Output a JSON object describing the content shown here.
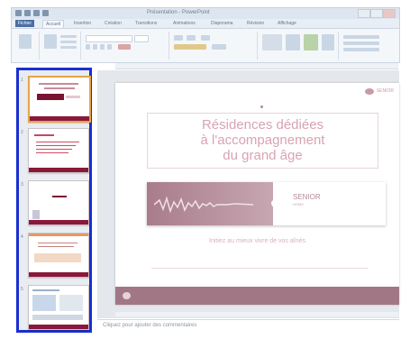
{
  "window": {
    "title": "Présentation - PowerPoint"
  },
  "ribbon": {
    "tabs": [
      "Fichier",
      "Accueil",
      "Insertion",
      "Création",
      "Transitions",
      "Animations",
      "Diaporama",
      "Révision",
      "Affichage"
    ],
    "active_tab": "Accueil"
  },
  "slides_panel": {
    "slides": [
      {
        "number": "1",
        "selected": true
      },
      {
        "number": "2",
        "selected": false
      },
      {
        "number": "3",
        "selected": false
      },
      {
        "number": "4",
        "selected": false
      },
      {
        "number": "5",
        "selected": false
      }
    ]
  },
  "slide": {
    "logo_text": "SENIOR",
    "title_lines": [
      "Résidences dédiées",
      "à l'accompagnement",
      "du grand âge"
    ],
    "band_brand": "SENIOR",
    "band_sub": "HOME",
    "band_sub2": "",
    "subtitle": "Initiez au mieux vivre de vos aînés",
    "footnote": "",
    "footer_text": ""
  },
  "notes": {
    "placeholder": "Cliquez pour ajouter des commentaires"
  },
  "colors": {
    "accent_selection": "#1a2fd0",
    "brand": "#a27785",
    "thumb_bar": "#8a1838"
  }
}
